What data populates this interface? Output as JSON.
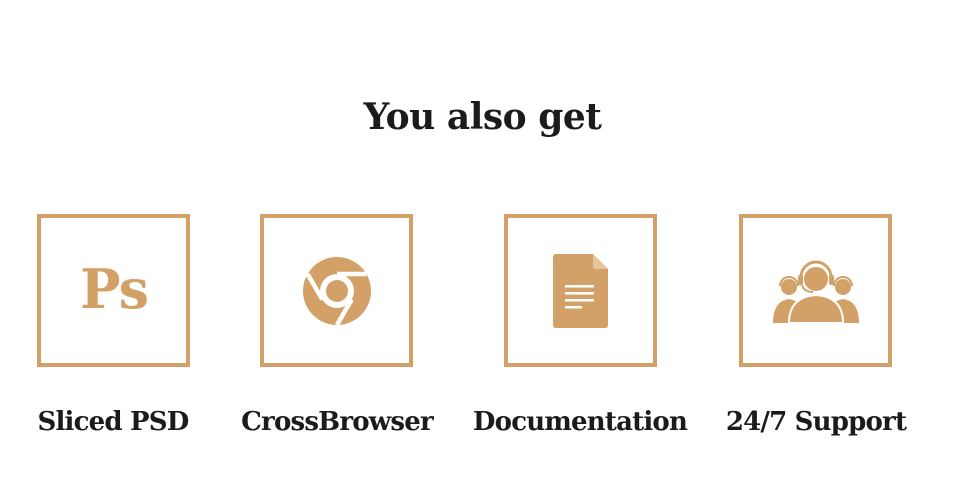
{
  "section": {
    "title": "You also get"
  },
  "colors": {
    "accent": "#d3a168",
    "heading": "#1b1b1b",
    "background": "#ffffff"
  },
  "features": [
    {
      "label": "Sliced PSD",
      "icon": "photoshop-icon",
      "icon_text": "Ps"
    },
    {
      "label": "CrossBrowser",
      "icon": "chrome-icon"
    },
    {
      "label": "Documentation",
      "icon": "document-icon"
    },
    {
      "label": "24/7 Support",
      "icon": "support-team-icon"
    }
  ]
}
